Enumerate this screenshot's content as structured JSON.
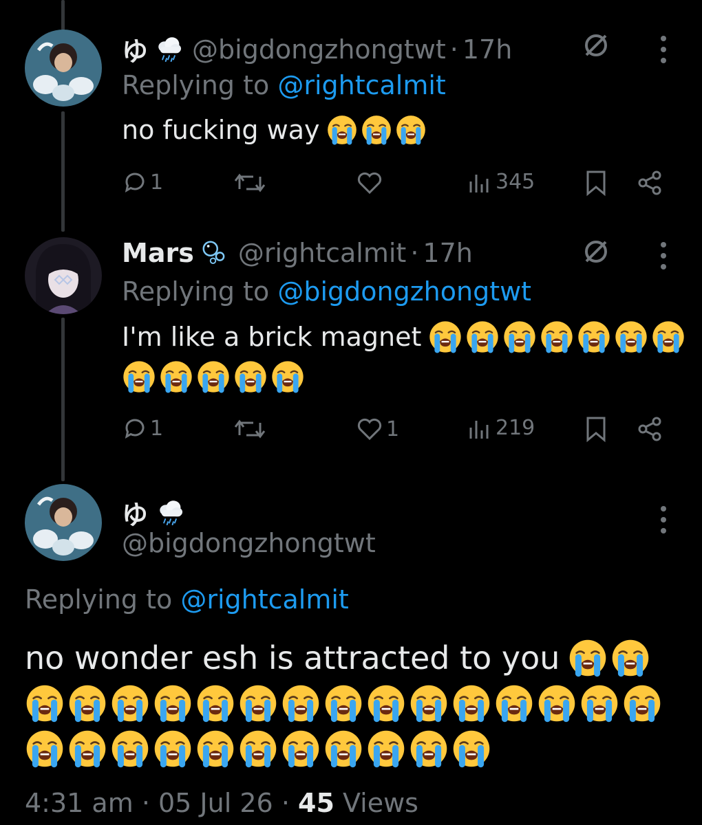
{
  "tweets": [
    {
      "display_name": "ゆ",
      "name_emoji": "cloud-with-rain",
      "handle": "@bigdongzhongtwt",
      "dot": "·",
      "time": "17h",
      "replying_label": "Replying to",
      "replying_to": "@rightcalmit",
      "text": "no fucking way",
      "emoji_count": 3,
      "replies": "1",
      "reposts": "",
      "likes": "",
      "views": "345"
    },
    {
      "display_name": "Mars",
      "name_emoji": "bubbles",
      "handle": "@rightcalmit",
      "dot": "·",
      "time": "17h",
      "replying_label": "Replying to",
      "replying_to": "@bigdongzhongtwt",
      "text": "I'm like a brick magnet",
      "emoji_count": 12,
      "replies": "1",
      "reposts": "",
      "likes": "1",
      "views": "219"
    }
  ],
  "main_tweet": {
    "display_name": "ゆ",
    "name_emoji": "cloud-with-rain",
    "handle": "@bigdongzhongtwt",
    "replying_label": "Replying to",
    "replying_to": "@rightcalmit",
    "text": "no wonder esh is attracted to you",
    "emoji_count": 28,
    "time": "4:31 am",
    "dot1": "·",
    "date": "05 Jul 26",
    "dot2": "·",
    "views_count": "45",
    "views_label": "Views"
  },
  "colors": {
    "background": "#000000",
    "text": "#e7e9ea",
    "muted": "#71767b",
    "link": "#1d9bf0",
    "thread_line": "#333639"
  }
}
